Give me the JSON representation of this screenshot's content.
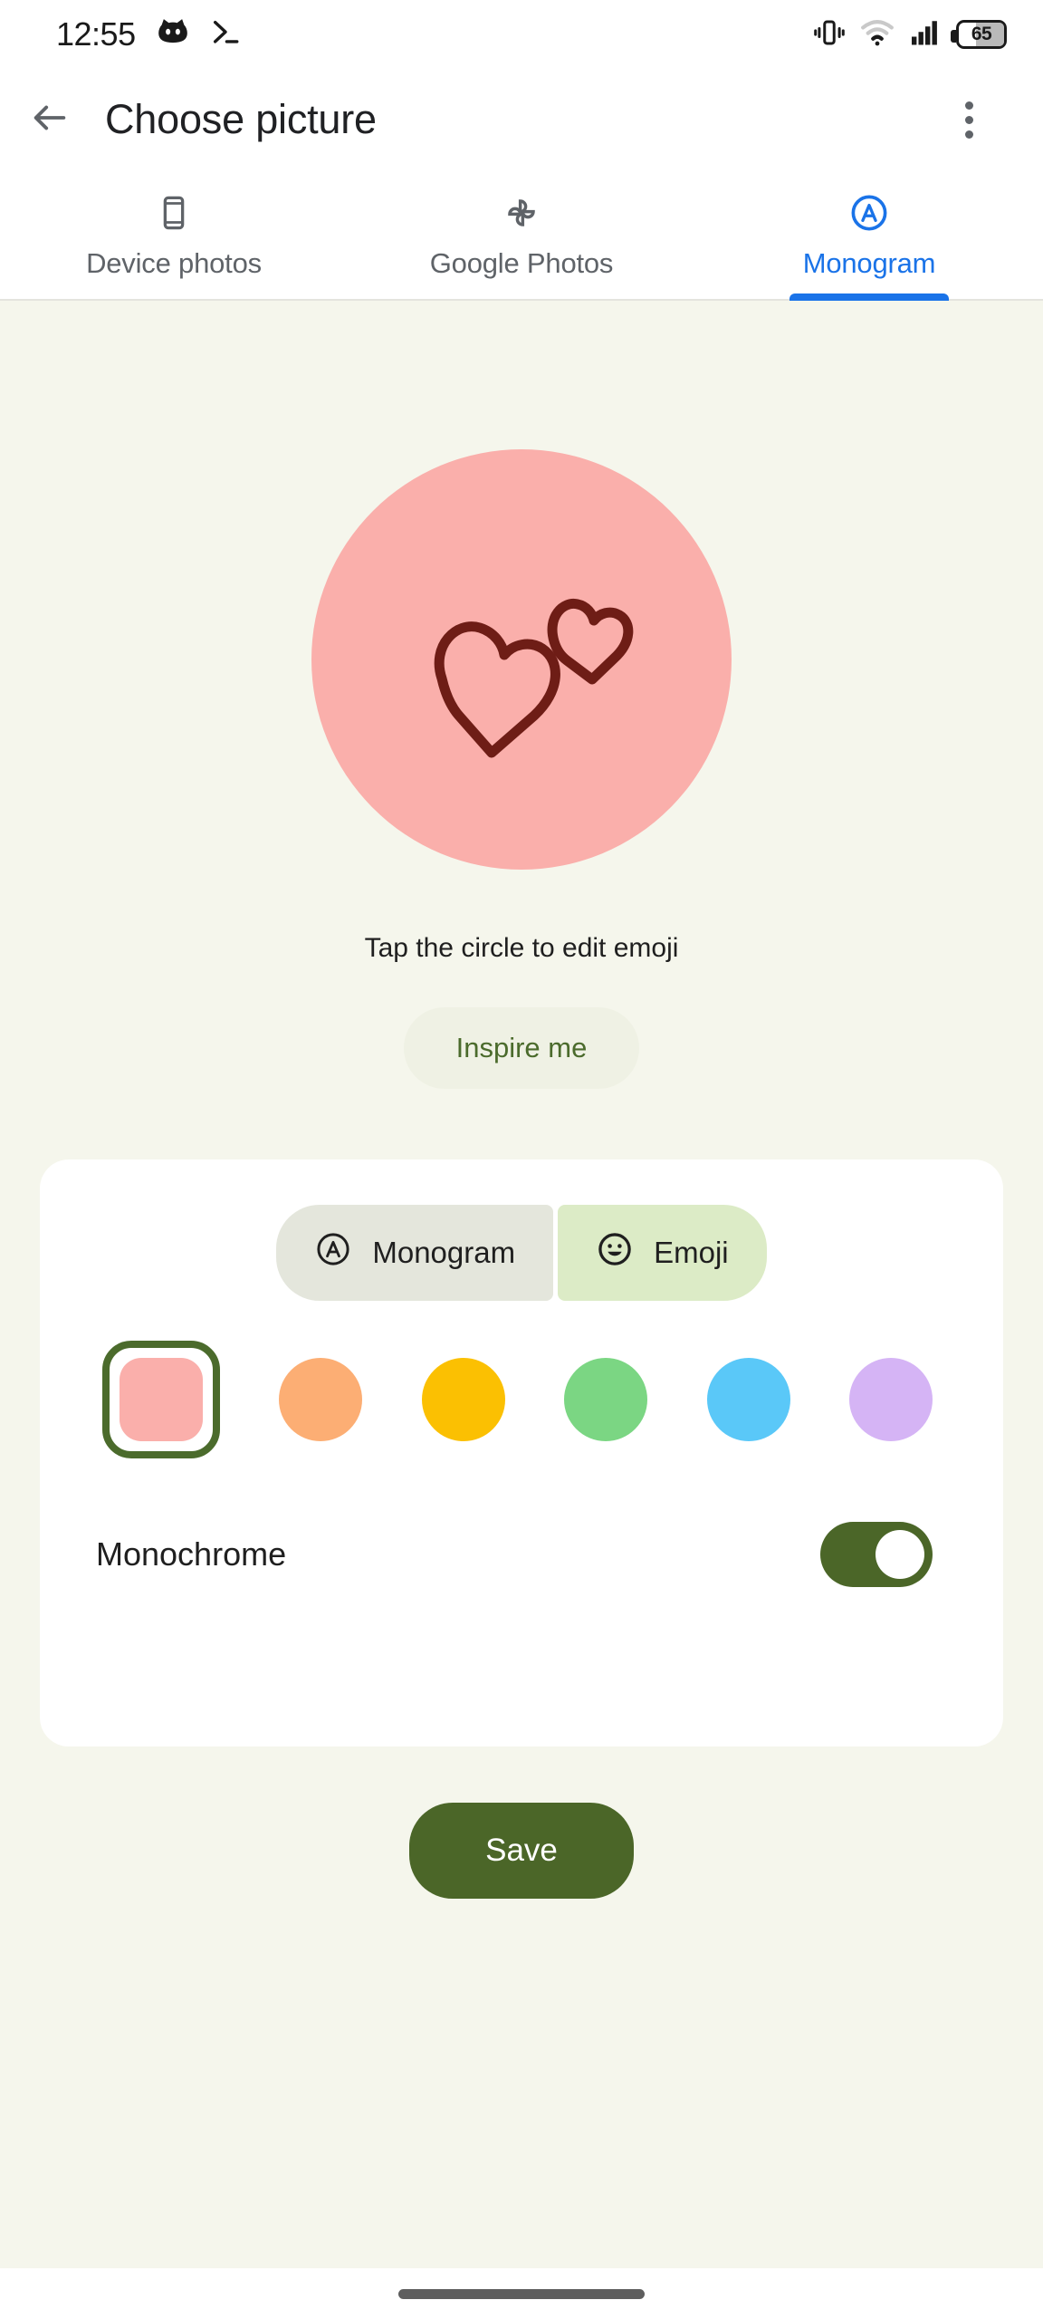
{
  "statusbar": {
    "time": "12:55",
    "battery_level": "65",
    "icons": [
      "cat-notification-icon",
      "terminal-icon",
      "vibrate-icon",
      "wifi-icon",
      "signal-icon",
      "battery-icon"
    ]
  },
  "appbar": {
    "title": "Choose picture",
    "back_icon": "back-arrow-icon",
    "overflow_icon": "more-vert-icon"
  },
  "tabs": [
    {
      "label": "Device photos",
      "icon": "phone-icon",
      "active": false
    },
    {
      "label": "Google Photos",
      "icon": "google-photos-pinwheel-icon",
      "active": false
    },
    {
      "label": "Monogram",
      "icon": "circled-a-icon",
      "active": true
    }
  ],
  "preview": {
    "avatar_bg_color": "#FAAFAB",
    "emoji_name": "two-hearts-emoji",
    "emoji_stroke_color": "#6E1D16",
    "hint": "Tap the circle to edit emoji",
    "inspire_label": "Inspire me"
  },
  "card": {
    "segments": [
      {
        "label": "Monogram",
        "icon": "circled-a-icon",
        "selected": false
      },
      {
        "label": "Emoji",
        "icon": "smiley-face-icon",
        "selected": true
      }
    ],
    "colors": [
      {
        "name": "pink",
        "hex": "#FAAFAB",
        "selected": true
      },
      {
        "name": "orange",
        "hex": "#FCAE74",
        "selected": false
      },
      {
        "name": "yellow",
        "hex": "#FBC002",
        "selected": false
      },
      {
        "name": "green",
        "hex": "#7BD683",
        "selected": false
      },
      {
        "name": "blue",
        "hex": "#5AC8F8",
        "selected": false
      },
      {
        "name": "purple",
        "hex": "#D5B4F5",
        "selected": false
      }
    ],
    "selection_ring_color": "#4B6B2C",
    "monochrome_label": "Monochrome",
    "monochrome_on": true
  },
  "footer": {
    "save_label": "Save"
  },
  "theme": {
    "background": "#F5F6EC",
    "accent_blue": "#1A73E8",
    "accent_green": "#4B6628"
  }
}
